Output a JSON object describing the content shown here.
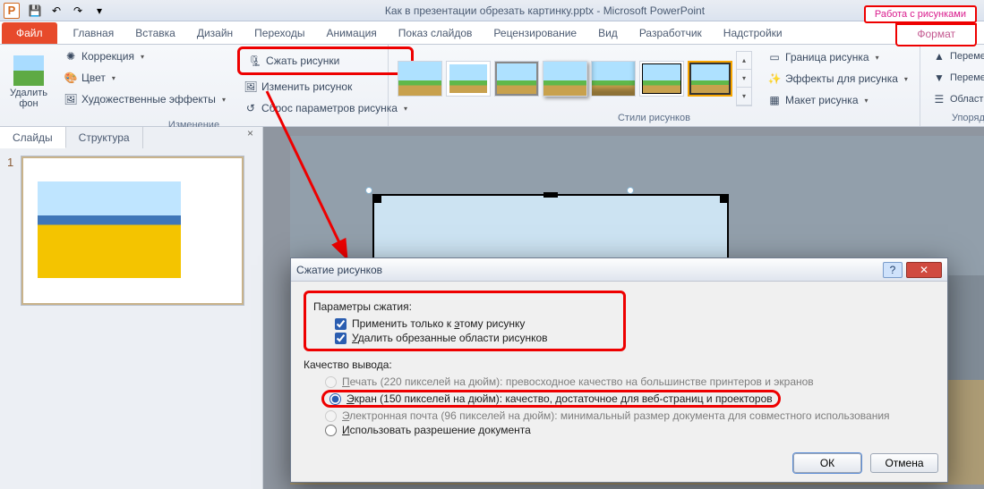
{
  "titlebar": {
    "title": "Как в презентации обрезать картинку.pptx - Microsoft PowerPoint"
  },
  "tabs": {
    "file": "Файл",
    "list": [
      "Главная",
      "Вставка",
      "Дизайн",
      "Переходы",
      "Анимация",
      "Показ слайдов",
      "Рецензирование",
      "Вид",
      "Разработчик",
      "Надстройки"
    ],
    "toolContext": "Работа с рисунками",
    "format": "Формат"
  },
  "ribbon": {
    "removeBg": "Удалить\nфон",
    "corrections": "Коррекция",
    "color": "Цвет",
    "artistic": "Художественные эффекты",
    "compress": "Сжать рисунки",
    "change": "Изменить рисунок",
    "reset": "Сброс параметров рисунка",
    "group_adjust": "Изменение",
    "group_styles": "Стили рисунков",
    "border": "Граница рисунка",
    "effects": "Эффекты для рисунка",
    "layout": "Макет рисунка",
    "forward": "Переместить вп",
    "backward": "Переместить н",
    "selection": "Область выдел",
    "group_arrange": "Упоряд"
  },
  "side": {
    "tab_slides": "Слайды",
    "tab_outline": "Структура",
    "slide_no": "1"
  },
  "dialog": {
    "title": "Сжатие рисунков",
    "section1_title": "Параметры сжатия:",
    "apply_only": "Применить только к этому рисунку",
    "delete_cropped": "Удалить обрезанные области рисунков",
    "section2_title": "Качество вывода:",
    "q_print": "Печать (220 пикселей на дюйм): превосходное качество на большинстве принтеров и экранов",
    "q_screen": "Экран (150 пикселей на дюйм): качество, достаточное для веб-страниц и проекторов",
    "q_email": "Электронная почта (96 пикселей на дюйм): минимальный размер документа для совместного использования",
    "q_doc": "Использовать разрешение документа",
    "ok": "ОК",
    "cancel": "Отмена"
  }
}
